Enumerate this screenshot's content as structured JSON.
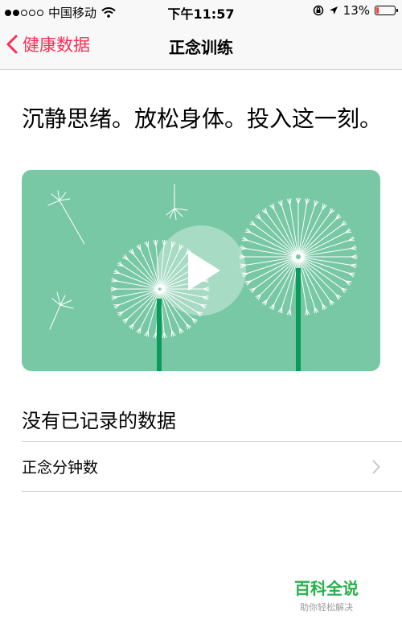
{
  "status_bar": {
    "carrier": "中国移动",
    "time": "下午11:57",
    "battery_percent": "13%",
    "battery_level": 0.13,
    "battery_color": "#ff3b30"
  },
  "nav": {
    "back_label": "健康数据",
    "title": "正念训练",
    "accent_color": "#ff2d55"
  },
  "main": {
    "headline": "沉静思绪。放松身体。投入这一刻。",
    "video": {
      "background_color": "#79c8a5",
      "play_icon": "play-icon"
    },
    "section_header": "没有已记录的数据",
    "rows": [
      {
        "label": "正念分钟数"
      }
    ]
  },
  "watermark": {
    "title": "百科全说",
    "subtitle": "助你轻松解决"
  }
}
